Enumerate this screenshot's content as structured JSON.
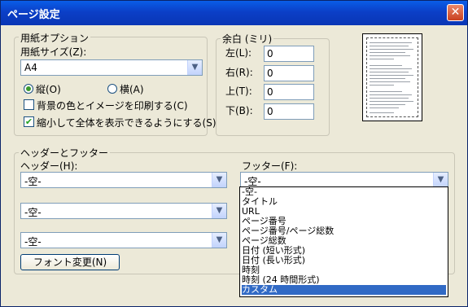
{
  "window": {
    "title": "ページ設定"
  },
  "paper": {
    "legend": "用紙オプション",
    "size_label": "用紙サイズ(Z):",
    "size_value": "A4",
    "portrait": "縦(O)",
    "landscape": "横(A)",
    "print_bg": "背景の色とイメージを印刷する(C)",
    "shrink": "縮小して全体を表示できるようにする(S)"
  },
  "margins": {
    "legend": "余白 (ミリ)",
    "left_label": "左(L):",
    "right_label": "右(R):",
    "top_label": "上(T):",
    "bottom_label": "下(B):",
    "left": "0",
    "right": "0",
    "top": "0",
    "bottom": "0"
  },
  "headerfooter": {
    "legend": "ヘッダーとフッター",
    "header_label": "ヘッダー(H):",
    "footer_label": "フッター(F):",
    "header1": "-空-",
    "header2": "-空-",
    "header3": "-空-",
    "footer1": "-空-",
    "font_button": "フォント変更(N)"
  },
  "footer_options": [
    "-空-",
    "タイトル",
    "URL",
    "ページ番号",
    "ページ番号/ページ総数",
    "ページ総数",
    "日付 (短い形式)",
    "日付 (長い形式)",
    "時刻",
    "時刻 (24 時間形式)",
    "カスタム"
  ],
  "icons": {
    "close": "close-icon",
    "dropdown": "chevron-down-icon"
  }
}
